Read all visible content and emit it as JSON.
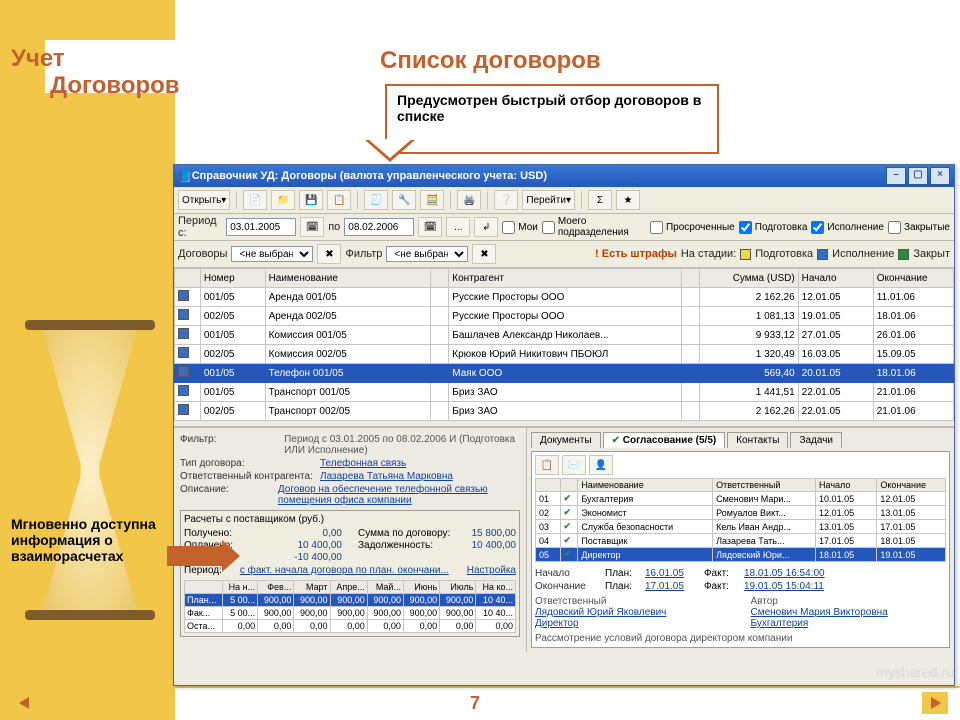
{
  "slide": {
    "logo1": "Учет",
    "logo2": "Договоров",
    "title": "Список договоров",
    "page_no": "7",
    "callout1": "Предусмотрен быстрый отбор договоров в списке",
    "callout2": "Мгновенно доступна информация о взаиморасчетах",
    "watermark": "myshared.ru"
  },
  "win": {
    "title": "Справочник УД: Договоры (валюта управленческого учета: USD)",
    "btn_open": "Открыть",
    "btn_goto": "Перейти",
    "period_from_label": "Период с:",
    "period_from": "03.01.2005",
    "period_to_label": "по",
    "period_to": "08.02.2006",
    "flt_mine": "Мои",
    "flt_dept": "Моего подразделения",
    "flt_overdue": "Просроченные",
    "flt_prep": "Подготовка",
    "flt_exec": "Исполнение",
    "flt_closed": "Закрытые",
    "contracts_label": "Договоры",
    "contracts_sel": "<не выбран>",
    "filter_label": "Фильтр",
    "filter_sel": "<не выбран>",
    "penalty_warn": "! Есть штрафы",
    "stage_label": "На стадии:",
    "stage_prep": "Подготовка",
    "stage_exec": "Исполнение",
    "stage_closed": "Закрыт"
  },
  "cols": {
    "num": "Номер",
    "name": "Наименование",
    "cparty": "Контрагент",
    "sum": "Сумма (USD)",
    "start": "Начало",
    "end": "Окончание"
  },
  "rows": [
    {
      "num": "001/05",
      "name": "Аренда 001/05",
      "cp": "Русские Просторы ООО",
      "sum": "2 162,26",
      "start": "12.01.05",
      "end": "11.01.06"
    },
    {
      "num": "002/05",
      "name": "Аренда 002/05",
      "cp": "Русские Просторы ООО",
      "sum": "1 081,13",
      "start": "19.01.05",
      "end": "18.01.06"
    },
    {
      "num": "001/05",
      "name": "Комиссия 001/05",
      "cp": "Башлачев Александр Николаев...",
      "sum": "9 933,12",
      "start": "27.01.05",
      "end": "26.01.06"
    },
    {
      "num": "002/05",
      "name": "Комиссия 002/05",
      "cp": "Крюков Юрий Никитович ПБОЮЛ",
      "sum": "1 320,49",
      "start": "16.03.05",
      "end": "15.09.05"
    },
    {
      "num": "001/05",
      "name": "Телефон 001/05",
      "cp": "Маяк ООО",
      "sum": "569,40",
      "start": "20.01.05",
      "end": "18.01.06"
    },
    {
      "num": "001/05",
      "name": "Транспорт 001/05",
      "cp": "Бриз ЗАО",
      "sum": "1 441,51",
      "start": "22.01.05",
      "end": "21.01.06"
    },
    {
      "num": "002/05",
      "name": "Транспорт 002/05",
      "cp": "Бриз ЗАО",
      "sum": "2 162,26",
      "start": "22.01.05",
      "end": "21.01.06"
    }
  ],
  "detail": {
    "filter_label": "Фильтр:",
    "filter_text": "Период с 03.01.2005 по 08.02.2006 И (Подготовка ИЛИ Исполнение)",
    "type_label": "Тип договора:",
    "type_val": "Телефонная связь",
    "resp_label": "Ответственный контрагента:",
    "resp_val": "Лазарева Татьяна Марковна",
    "desc_label": "Описание:",
    "desc_val": "Договор на обеспечение телефонной связью помещения офиса компании"
  },
  "calc": {
    "title": "Расчеты с поставщиком (руб.)",
    "received_label": "Получено:",
    "received": "0,00",
    "paid_label": "Оплачено:",
    "paid": "10 400,00",
    "balance_label": "Остаток:",
    "balance": "-10 400,00",
    "bysum_label": "Сумма по договору:",
    "bysum": "15 800,00",
    "debt_label": "Задолженность:",
    "debt": "10 400,00",
    "period_label": "Период:",
    "period_val": "с факт. начала договора по план. окончани...",
    "settings": "Настройка"
  },
  "months": {
    "headers": [
      "",
      "На н...",
      "Фев...",
      "Март",
      "Апре...",
      "Май...",
      "Июнь",
      "Июль",
      "На ко..."
    ],
    "rows": [
      {
        "label": "План...",
        "v": [
          "5 00...",
          "900,00",
          "900,00",
          "900,00",
          "900,00",
          "900,00",
          "900,00",
          "10 40..."
        ]
      },
      {
        "label": "Фак...",
        "v": [
          "5 00...",
          "900,00",
          "900,00",
          "900,00",
          "900,00",
          "900,00",
          "900,00",
          "10 40..."
        ]
      },
      {
        "label": "Оста...",
        "v": [
          "0,00",
          "0,00",
          "0,00",
          "0,00",
          "0,00",
          "0,00",
          "0,00",
          "0,00"
        ]
      }
    ]
  },
  "tabs": {
    "docs": "Документы",
    "appr": "Согласование (5/5)",
    "contacts": "Контакты",
    "tasks": "Задачи"
  },
  "appr_cols": {
    "name": "Наименование",
    "resp": "Ответственный",
    "start": "Начало",
    "end": "Окончание"
  },
  "appr_rows": [
    {
      "n": "01",
      "name": "Бухгалтерия",
      "resp": "Сменович Мари...",
      "start": "10.01.05",
      "end": "12.01.05"
    },
    {
      "n": "02",
      "name": "Экономист",
      "resp": "Ромуалов Викт...",
      "start": "12.01.05",
      "end": "13.01.05"
    },
    {
      "n": "03",
      "name": "Служба безопасности",
      "resp": "Кель Иван Андр...",
      "start": "13.01.05",
      "end": "17.01.05"
    },
    {
      "n": "04",
      "name": "Поставщик",
      "resp": "Лазарева Тать...",
      "start": "17.01.05",
      "end": "18.01.05"
    },
    {
      "n": "05",
      "name": "Директор",
      "resp": "Лядовский Юри...",
      "start": "18.01.05",
      "end": "19.01.05"
    }
  ],
  "appr_detail": {
    "start_label": "Начало",
    "start_plan_l": "План:",
    "start_plan": "16.01.05",
    "start_fact_l": "Факт:",
    "start_fact": "18.01.05 16:54:00",
    "end_label": "Окончание",
    "end_plan": "17.01.05",
    "end_fact": "19.01.05 15:04:11",
    "resp_l": "Ответственный",
    "author_l": "Автор",
    "resp_v": "Лядовский Юрий Яковлевич",
    "author_v": "Сменович Мария Викторовна",
    "org_l": "Директор",
    "org_v": "Бухгалтерия",
    "note": "Рассмотрение условий договора директором компании"
  }
}
